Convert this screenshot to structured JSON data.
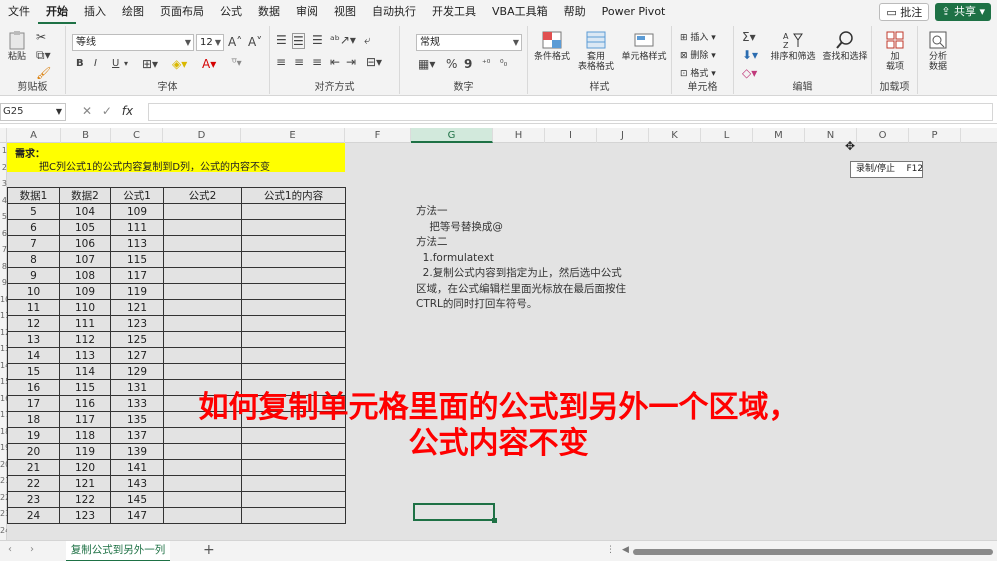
{
  "menu": {
    "items": [
      "文件",
      "开始",
      "插入",
      "绘图",
      "页面布局",
      "公式",
      "数据",
      "审阅",
      "视图",
      "自动执行",
      "开发工具",
      "VBA工具箱",
      "帮助",
      "Power Pivot"
    ],
    "active_index": 1,
    "comment_label": "批注",
    "share_label": "共享"
  },
  "ribbon": {
    "clipboard": {
      "paste_label": "粘贴",
      "group_label": "剪贴板"
    },
    "font": {
      "font_name": "等线",
      "font_size": "12",
      "bold": "B",
      "italic": "I",
      "underline": "U",
      "group_label": "字体"
    },
    "alignment": {
      "group_label": "对齐方式"
    },
    "number": {
      "format": "常规",
      "percent": "%",
      "comma": "9",
      "group_label": "数字"
    },
    "styles": {
      "conditional_label": "条件格式",
      "table_label": "套用\n表格格式",
      "cell_style_label": "单元格样式",
      "group_label": "样式"
    },
    "cells": {
      "insert_label": "插入",
      "delete_label": "删除",
      "format_label": "格式",
      "group_label": "单元格"
    },
    "editing": {
      "sort_label": "排序和筛选",
      "find_label": "查找和选择",
      "group_label": "编辑"
    },
    "addins": {
      "addin_label": "加\n载项",
      "group_label": "加载项"
    },
    "analysis": {
      "label": "分析\n数据"
    }
  },
  "formula_bar": {
    "cell_ref": "G25",
    "fx": "fx",
    "value": ""
  },
  "columns": [
    "A",
    "B",
    "C",
    "D",
    "E",
    "F",
    "G",
    "H",
    "I",
    "J",
    "K",
    "L",
    "M",
    "N",
    "O",
    "P"
  ],
  "selected_column": "G",
  "requirement": {
    "title": "需求：",
    "text": "把C列公式1的公式内容复制到D列，公式的内容不变"
  },
  "table": {
    "headers": [
      "数据1",
      "数据2",
      "公式1",
      "公式2",
      "公式1的内容"
    ],
    "rows": [
      [
        "5",
        "104",
        "109",
        "",
        ""
      ],
      [
        "6",
        "105",
        "111",
        "",
        ""
      ],
      [
        "7",
        "106",
        "113",
        "",
        ""
      ],
      [
        "8",
        "107",
        "115",
        "",
        ""
      ],
      [
        "9",
        "108",
        "117",
        "",
        ""
      ],
      [
        "10",
        "109",
        "119",
        "",
        ""
      ],
      [
        "11",
        "110",
        "121",
        "",
        ""
      ],
      [
        "12",
        "111",
        "123",
        "",
        ""
      ],
      [
        "13",
        "112",
        "125",
        "",
        ""
      ],
      [
        "14",
        "113",
        "127",
        "",
        ""
      ],
      [
        "15",
        "114",
        "129",
        "",
        ""
      ],
      [
        "16",
        "115",
        "131",
        "",
        ""
      ],
      [
        "17",
        "116",
        "133",
        "",
        ""
      ],
      [
        "18",
        "117",
        "135",
        "",
        ""
      ],
      [
        "19",
        "118",
        "137",
        "",
        ""
      ],
      [
        "20",
        "119",
        "139",
        "",
        ""
      ],
      [
        "21",
        "120",
        "141",
        "",
        ""
      ],
      [
        "22",
        "121",
        "143",
        "",
        ""
      ],
      [
        "23",
        "122",
        "145",
        "",
        ""
      ],
      [
        "24",
        "123",
        "147",
        "",
        ""
      ]
    ]
  },
  "methods": [
    "方法一",
    "    把等号替换成@",
    "方法二",
    "  1.formulatext",
    "  2.复制公式内容到指定为止，然后选中公式",
    "区域，在公式编辑栏里面光标放在最后面按住",
    "CTRL的同时打回车符号。"
  ],
  "tooltip": "录制/停止    F12",
  "overlay": {
    "line1": "如何复制单元格里面的公式到另外一个区域，",
    "line2": "公式内容不变",
    "color": "#ff0000"
  },
  "row_numbers": [
    "1",
    "2",
    "3",
    "4",
    "5",
    "6",
    "7",
    "8",
    "9",
    "10",
    "11",
    "12",
    "13",
    "14",
    "15",
    "16",
    "17",
    "18",
    "19",
    "20",
    "21",
    "22",
    "23",
    "24"
  ],
  "sheet_tab": "复制公式到另外一列",
  "accent_color": "#1e7145"
}
